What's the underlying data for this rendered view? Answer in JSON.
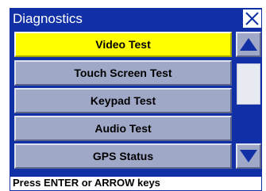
{
  "header": {
    "title": "Diagnostics",
    "close_icon": "close-icon"
  },
  "menu": {
    "items": [
      {
        "label": "Video Test",
        "selected": true
      },
      {
        "label": "Touch Screen Test",
        "selected": false
      },
      {
        "label": "Keypad Test",
        "selected": false
      },
      {
        "label": "Audio Test",
        "selected": false
      },
      {
        "label": "GPS Status",
        "selected": false
      }
    ]
  },
  "scroll": {
    "up_icon": "arrow-up-icon",
    "down_icon": "arrow-down-icon"
  },
  "status": {
    "text": "Press ENTER or ARROW keys"
  },
  "colors": {
    "background": "#1230a6",
    "selected": "#ffff00",
    "button": "#a0a8c8",
    "arrow": "#1230a6"
  }
}
